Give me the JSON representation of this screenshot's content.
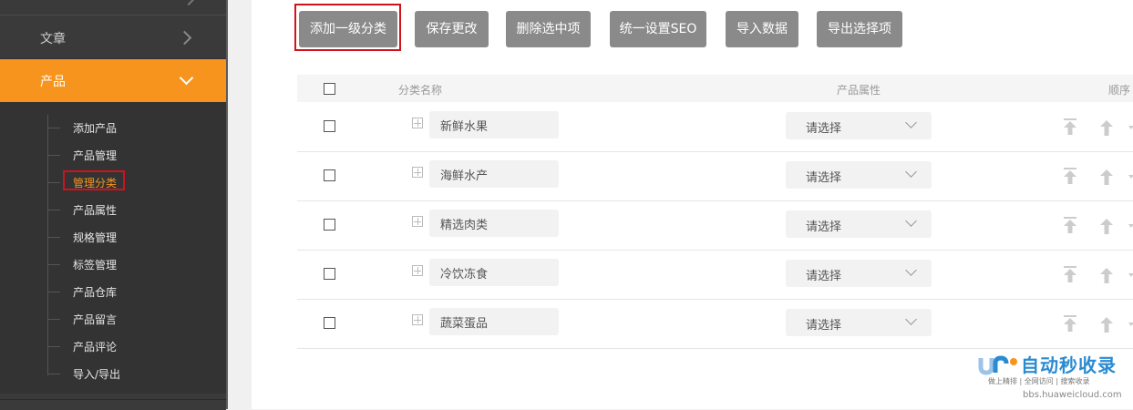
{
  "sidebar": {
    "top_partial_label": "",
    "items": [
      {
        "label": "文章",
        "state": "collapsed"
      },
      {
        "label": "产品",
        "state": "expanded"
      }
    ],
    "submenu": [
      {
        "label": "添加产品"
      },
      {
        "label": "产品管理"
      },
      {
        "label": "管理分类",
        "selected": true
      },
      {
        "label": "产品属性"
      },
      {
        "label": "规格管理"
      },
      {
        "label": "标签管理"
      },
      {
        "label": "产品仓库"
      },
      {
        "label": "产品留言"
      },
      {
        "label": "产品评论"
      },
      {
        "label": "导入/导出"
      }
    ],
    "accent_color": "#f7941d"
  },
  "toolbar": {
    "buttons": [
      {
        "label": "添加一级分类",
        "highlighted": true
      },
      {
        "label": "保存更改"
      },
      {
        "label": "删除选中项"
      },
      {
        "label": "统一设置SEO"
      },
      {
        "label": "导入数据"
      },
      {
        "label": "导出选择项"
      }
    ]
  },
  "table": {
    "columns": [
      "分类名称",
      "产品属性",
      "顺序"
    ],
    "rows": [
      {
        "name": "新鲜水果",
        "attribute": "请选择"
      },
      {
        "name": "海鲜水产",
        "attribute": "请选择"
      },
      {
        "name": "精选肉类",
        "attribute": "请选择"
      },
      {
        "name": "冷饮冻食",
        "attribute": "请选择"
      },
      {
        "name": "蔬菜蛋品",
        "attribute": "请选择"
      }
    ]
  },
  "watermark": {
    "title": "自动秒收录",
    "subtitle": "做上精排 | 全网访问 | 搜索收录",
    "url": "bbs.huaweicloud.com"
  }
}
